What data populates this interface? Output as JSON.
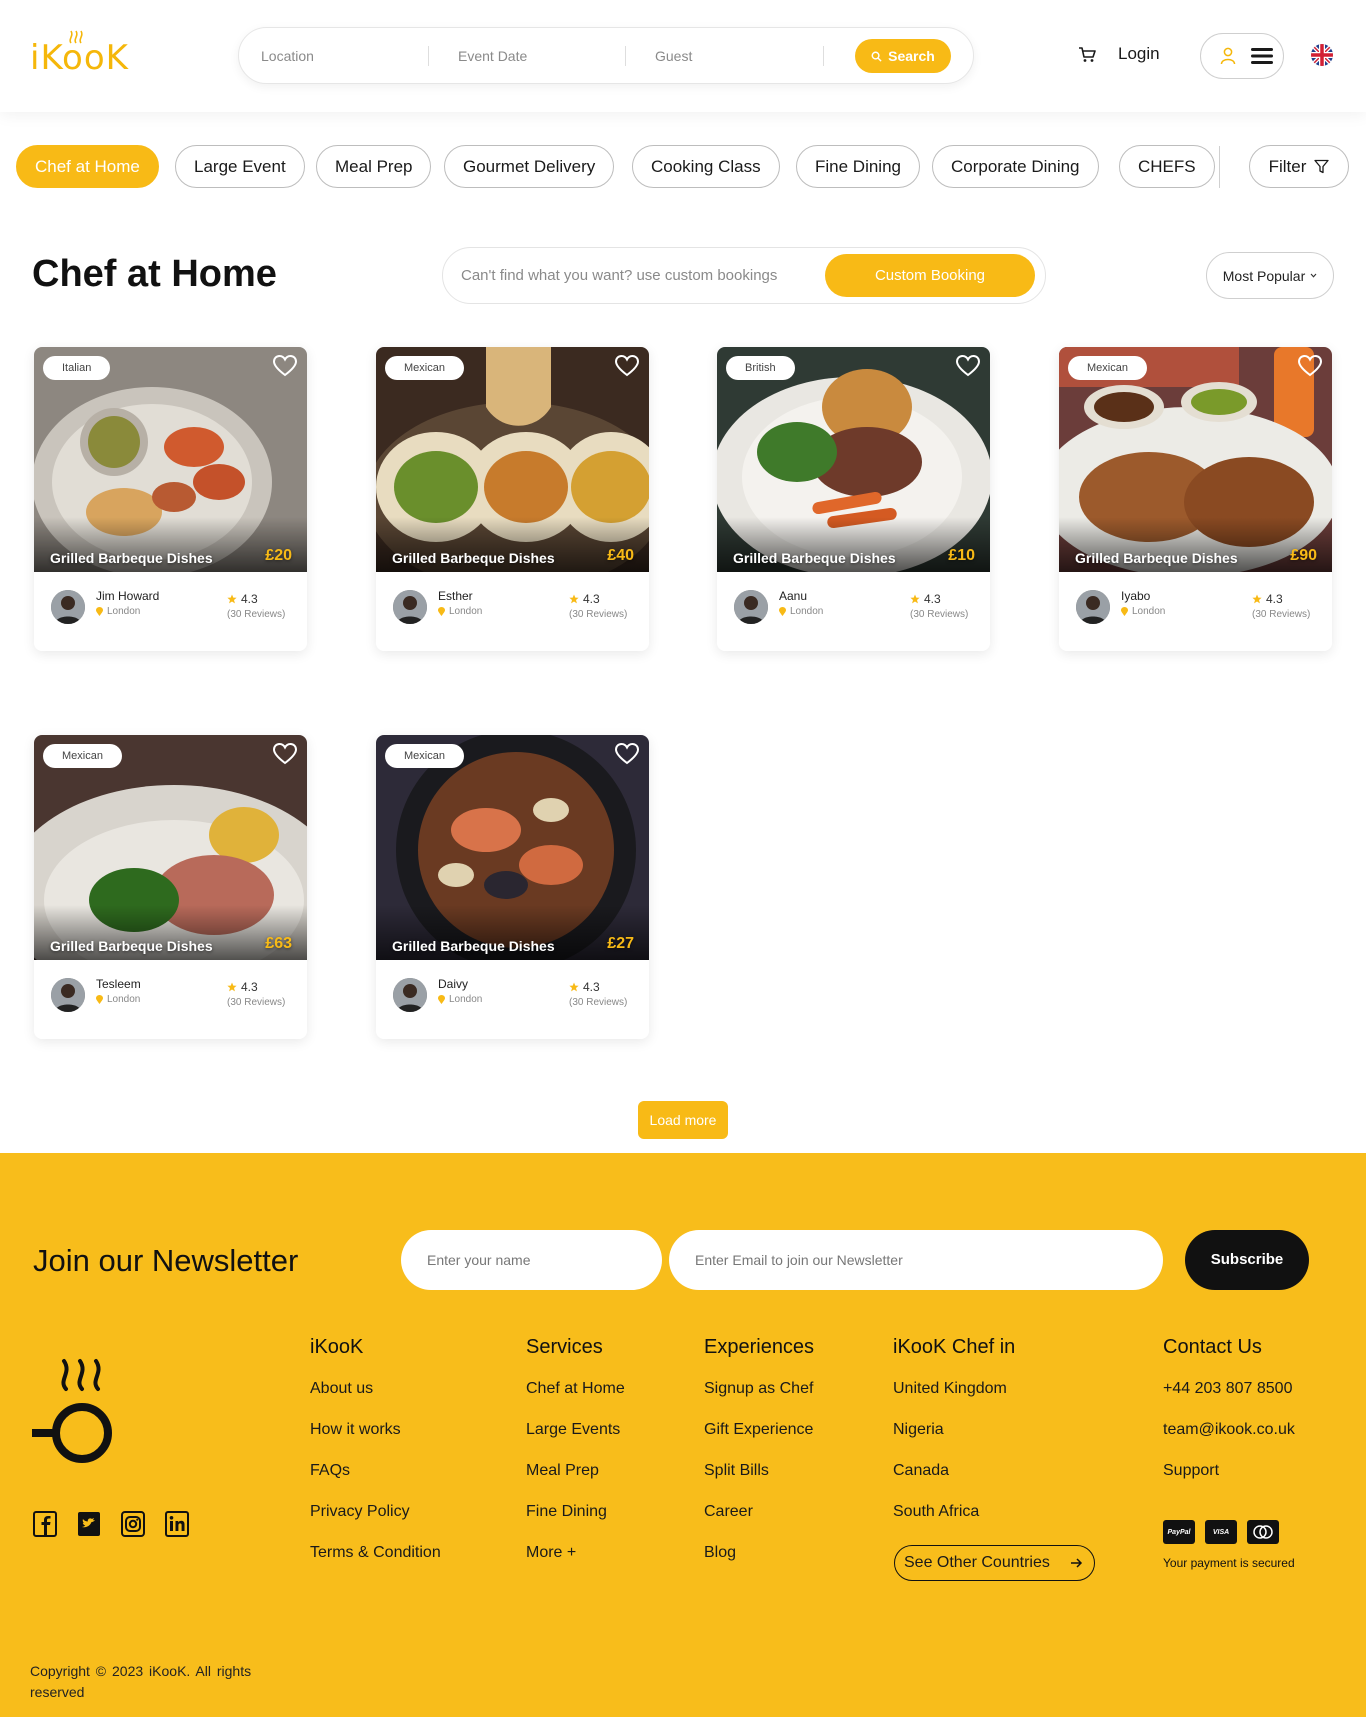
{
  "brand": {
    "logo_text": "iKooK",
    "primary_color": "#F8BA16"
  },
  "header": {
    "search": {
      "location_placeholder": "Location",
      "date_placeholder": "Event Date",
      "guest_placeholder": "Guest",
      "search_label": "Search"
    },
    "login_label": "Login",
    "icons": [
      "cart-icon",
      "user-icon",
      "menu-icon",
      "uk-flag-icon"
    ]
  },
  "categories": {
    "items": [
      "Chef at Home",
      "Large Event",
      "Meal Prep",
      "Gourmet Delivery",
      "Cooking Class",
      "Fine Dining",
      "Corporate Dining",
      "CHEFS"
    ],
    "active": "Chef at Home",
    "filter_label": "Filter"
  },
  "section": {
    "title": "Chef at Home",
    "custom_prompt": "Can't find what you want? use custom bookings",
    "custom_button": "Custom Booking",
    "sort_label": "Most Popular"
  },
  "cards": [
    {
      "cuisine": "Italian",
      "dish": "Grilled Barbeque Dishes",
      "price": "£20",
      "chef": "Jim Howard",
      "location": "London",
      "rating": "4.3",
      "reviews": "(30 Reviews)"
    },
    {
      "cuisine": "Mexican",
      "dish": "Grilled Barbeque Dishes",
      "price": "£40",
      "chef": "Esther",
      "location": "London",
      "rating": "4.3",
      "reviews": "(30 Reviews)"
    },
    {
      "cuisine": "British",
      "dish": "Grilled Barbeque Dishes",
      "price": "£10",
      "chef": "Aanu",
      "location": "London",
      "rating": "4.3",
      "reviews": "(30 Reviews)"
    },
    {
      "cuisine": "Mexican",
      "dish": "Grilled Barbeque Dishes",
      "price": "£90",
      "chef": "Iyabo",
      "location": "London",
      "rating": "4.3",
      "reviews": "(30 Reviews)"
    },
    {
      "cuisine": "Mexican",
      "dish": "Grilled Barbeque Dishes",
      "price": "£63",
      "chef": "Tesleem",
      "location": "London",
      "rating": "4.3",
      "reviews": "(30 Reviews)"
    },
    {
      "cuisine": "Mexican",
      "dish": "Grilled Barbeque Dishes",
      "price": "£27",
      "chef": "Daivy",
      "location": "London",
      "rating": "4.3",
      "reviews": "(30 Reviews)"
    }
  ],
  "load_more_label": "Load more",
  "footer": {
    "newsletter": {
      "title": "Join our Newsletter",
      "name_placeholder": "Enter your name",
      "email_placeholder": "Enter Email to join our Newsletter",
      "subscribe_label": "Subscribe"
    },
    "columns": [
      {
        "heading": "iKooK",
        "links": [
          "About us",
          "How it works",
          "FAQs",
          "Privacy Policy",
          "Terms & Condition"
        ]
      },
      {
        "heading": "Services",
        "links": [
          "Chef at Home",
          "Large Events",
          "Meal Prep",
          "Fine Dining",
          "More +"
        ]
      },
      {
        "heading": "Experiences",
        "links": [
          "Signup as Chef",
          "Gift Experience",
          "Split Bills",
          "Career",
          "Blog"
        ]
      },
      {
        "heading": "iKooK Chef in",
        "links": [
          "United Kingdom",
          "Nigeria",
          "Canada",
          "South Africa"
        ]
      },
      {
        "heading": "Contact Us",
        "links": [
          "+44 203 807 8500",
          "team@ikook.co.uk",
          "Support"
        ]
      }
    ],
    "see_other_countries": "See Other Countries",
    "payment_methods": [
      "PayPal",
      "VISA",
      "mastercard"
    ],
    "payment_note": "Your payment is secured",
    "social_icons": [
      "facebook-icon",
      "twitter-icon",
      "instagram-icon",
      "linkedin-icon"
    ],
    "copyright": "Copyright © 2023 iKooK. All rights reserved"
  }
}
